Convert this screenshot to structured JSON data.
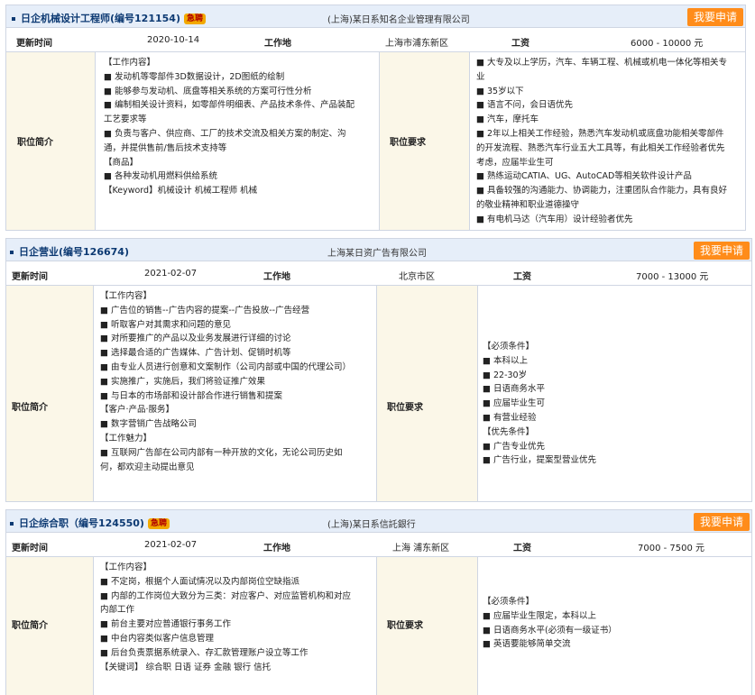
{
  "labels": {
    "updated": "更新时间",
    "location": "工作地",
    "salary": "工资",
    "desc": "职位简介",
    "req": "职位要求"
  },
  "apply_label": "我要申请",
  "urgent_badge": "急聘",
  "jobs": [
    {
      "title": "日企机械设计工程师(编号121154)",
      "company": "(上海)某日系知名企业管理有限公司",
      "updated": "2020-10-14",
      "location": "上海市浦东新区",
      "salary": "6000 - 10000 元",
      "desc": [
        "【工作内容】",
        "■ 发动机等零部件3D数据设计，2D图纸的绘制",
        "■ 能够参与发动机、底盘等相关系统的方案可行性分析",
        "■ 编制相关设计资料，如零部件明细表、产品技术条件、产品装配",
        "工艺要求等",
        "■ 负责与客户、供应商、工厂的技术交流及相关方案的制定、沟",
        "通，并提供售前/售后技术支持等",
        "",
        "【商品】",
        "■ 各种发动机用燃料供给系统",
        "",
        "【Keyword】机械设计 机械工程师 机械"
      ],
      "req": [
        "■ 大专及以上学历，汽车、车辆工程、机械或机电一体化等相关专",
        "业",
        "■ 35岁以下",
        "■ 语言不问，会日语优先",
        "■ 汽车，摩托车",
        "■ 2年以上相关工作经验，熟悉汽车发动机或底盘功能相关零部件",
        "的开发流程、熟悉汽车行业五大工具等，有此相关工作经验者优先",
        "考虑，应届毕业生可",
        "■ 熟练运动CATIA、UG、AutoCAD等相关软件设计产品",
        "■ 具备较强的沟通能力、协调能力，注重团队合作能力，具有良好",
        "的敬业精神和职业道德操守",
        "■ 有电机马达（汽车用）设计经验者优先"
      ]
    },
    {
      "title": "日企营业(编号126674)",
      "company": "上海某日资广告有限公司",
      "updated": "2021-02-07",
      "location": "北京市区",
      "salary": "7000 - 13000 元",
      "desc": [
        "【工作内容】",
        "■ 广告位的销售--广告内容的提案--广告投放--广告经营",
        "■ 听取客户对其需求和问题的意见",
        "■ 对所要推广的产品以及业务发展进行详细的讨论",
        "■ 选择最合适的广告媒体、广告计划、促销时机等",
        "■ 由专业人员进行创意和文案制作（公司内部或中国的代理公司）",
        "■ 实施推广，实施后，我们将验证推广效果",
        "■ 与日本的市场部和设计部合作进行销售和提案",
        "",
        "【客户·产品·服务】",
        "■ 数字营销广告战略公司",
        "",
        "【工作魅力】",
        "■ 互联网广告部在公司内部有一种开放的文化，无论公司历史如",
        "何，都欢迎主动提出意见"
      ],
      "req": [
        "【必须条件】",
        "■ 本科以上",
        "■ 22-30岁",
        "■ 日语商务水平",
        "■ 应届毕业生可",
        "■ 有营业经验",
        "",
        "【优先条件】",
        "■ 广告专业优先",
        "■ 广告行业，提案型营业优先"
      ]
    },
    {
      "title": "日企综合职（编号124550)",
      "company": "(上海)某日系信託銀行",
      "updated": "2021-02-07",
      "location": "上海 浦东新区",
      "salary": "7000 - 7500 元",
      "desc": [
        "【工作内容】",
        "■ 不定岗，根据个人面试情况以及内部岗位空缺指派",
        "■ 内部的工作岗位大致分为三类：对应客户、对应监管机构和对应",
        "内部工作",
        "■ 前台主要对应普通银行事务工作",
        "■ 中台内容类似客户信息管理",
        "■ 后台负责票据系统录入、存汇款管理账户设立等工作",
        "",
        "【关键词】 综合职 日语 证券 金融 银行 信托"
      ],
      "req": [
        "【必须条件】",
        "■ 应届毕业生限定，本科以上",
        "■ 日语商务水平(必须有一级证书）",
        "■ 英语要能够简单交流"
      ]
    }
  ]
}
